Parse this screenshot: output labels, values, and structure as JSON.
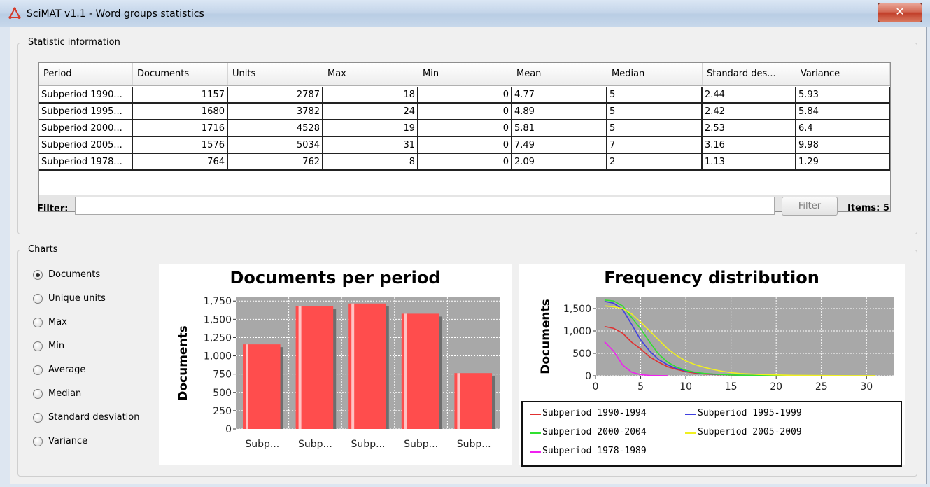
{
  "window": {
    "title": "SciMAT v1.1 - Word groups statistics",
    "close_glyph": "✕"
  },
  "statistic_group": {
    "label": "Statistic information",
    "columns": [
      "Period",
      "Documents",
      "Units",
      "Max",
      "Min",
      "Mean",
      "Median",
      "Standard des...",
      "Variance"
    ],
    "rows": [
      [
        "Subperiod 1990...",
        "1157",
        "2787",
        "18",
        "0",
        "4.77",
        "5",
        "2.44",
        "5.93"
      ],
      [
        "Subperiod 1995...",
        "1680",
        "3782",
        "24",
        "0",
        "4.89",
        "5",
        "2.42",
        "5.84"
      ],
      [
        "Subperiod 2000...",
        "1716",
        "4528",
        "19",
        "0",
        "5.81",
        "5",
        "2.53",
        "6.4"
      ],
      [
        "Subperiod 2005...",
        "1576",
        "5034",
        "31",
        "0",
        "7.49",
        "7",
        "3.16",
        "9.98"
      ],
      [
        "Subperiod 1978...",
        "764",
        "762",
        "8",
        "0",
        "2.09",
        "2",
        "1.13",
        "1.29"
      ]
    ],
    "filter_label": "Filter:",
    "filter_value": "",
    "filter_button": "Filter",
    "items_label": "Items: 5"
  },
  "charts_group": {
    "label": "Charts",
    "options": [
      {
        "label": "Documents",
        "selected": true
      },
      {
        "label": "Unique units",
        "selected": false
      },
      {
        "label": "Max",
        "selected": false
      },
      {
        "label": "Min",
        "selected": false
      },
      {
        "label": "Average",
        "selected": false
      },
      {
        "label": "Median",
        "selected": false
      },
      {
        "label": "Standard desviation",
        "selected": false
      },
      {
        "label": "Variance",
        "selected": false
      }
    ]
  },
  "chart_data": [
    {
      "type": "bar",
      "title": "Documents per period",
      "xlabel": "",
      "ylabel": "Documents",
      "categories": [
        "Subp...",
        "Subp...",
        "Subp...",
        "Subp...",
        "Subp..."
      ],
      "values": [
        1157,
        1680,
        1716,
        1576,
        764
      ],
      "ylim": [
        0,
        1800
      ],
      "yticks": [
        0,
        250,
        500,
        750,
        1000,
        1250,
        1500,
        1750
      ],
      "ytick_labels": [
        "0",
        "250",
        "500",
        "750",
        "1,000",
        "1,250",
        "1,500",
        "1,750"
      ],
      "grid": true,
      "colors": {
        "bar": "#ff4d4d",
        "plot_bg": "#a8a8a8",
        "shadow": "#6e6e6e",
        "grid": "#ffffff"
      }
    },
    {
      "type": "line",
      "title": "Frequency distribution",
      "xlabel": "",
      "ylabel": "Documents",
      "xlim": [
        0,
        33
      ],
      "ylim": [
        0,
        1750
      ],
      "xticks": [
        0,
        5,
        10,
        15,
        20,
        25,
        30
      ],
      "yticks": [
        0,
        500,
        1000,
        1500
      ],
      "ytick_labels": [
        "0",
        "500",
        "1,000",
        "1,500"
      ],
      "grid": true,
      "legend_position": "bottom",
      "colors": {
        "plot_bg": "#a8a8a8",
        "grid": "#ffffff"
      },
      "series": [
        {
          "name": "Subperiod 1990-1994",
          "color": "#e03030",
          "x": [
            1,
            2,
            3,
            4,
            5,
            6,
            7,
            8,
            9,
            10,
            11,
            12,
            13,
            14,
            15,
            16,
            18,
            20,
            22,
            24
          ],
          "y": [
            1100,
            1060,
            950,
            750,
            600,
            420,
            300,
            200,
            140,
            90,
            60,
            40,
            30,
            20,
            15,
            10,
            6,
            4,
            2,
            1
          ]
        },
        {
          "name": "Subperiod 1995-1999",
          "color": "#4040e0",
          "x": [
            1,
            2,
            3,
            4,
            5,
            6,
            7,
            8,
            9,
            10,
            11,
            12,
            13,
            14,
            15,
            16,
            18,
            20,
            22,
            24
          ],
          "y": [
            1660,
            1620,
            1480,
            1150,
            800,
            550,
            360,
            240,
            160,
            110,
            75,
            50,
            35,
            25,
            18,
            12,
            7,
            4,
            2,
            1
          ]
        },
        {
          "name": "Subperiod 2000-2004",
          "color": "#30e030",
          "x": [
            1,
            2,
            3,
            4,
            5,
            6,
            7,
            8,
            9,
            10,
            11,
            12,
            13,
            14,
            15,
            16,
            18,
            20,
            22,
            24
          ],
          "y": [
            1690,
            1670,
            1560,
            1300,
            1050,
            750,
            480,
            300,
            190,
            120,
            80,
            55,
            38,
            26,
            18,
            12,
            7,
            4,
            2,
            1
          ]
        },
        {
          "name": "Subperiod 2005-2009",
          "color": "#f0f020",
          "x": [
            1,
            2,
            3,
            4,
            5,
            6,
            7,
            8,
            9,
            10,
            11,
            12,
            13,
            14,
            15,
            16,
            18,
            20,
            22,
            24,
            28,
            31
          ],
          "y": [
            1560,
            1540,
            1500,
            1380,
            1200,
            1000,
            800,
            600,
            450,
            330,
            250,
            190,
            140,
            100,
            70,
            50,
            30,
            18,
            10,
            6,
            2,
            1
          ]
        },
        {
          "name": "Subperiod 1978-1989",
          "color": "#f020f0",
          "x": [
            1,
            2,
            3,
            4,
            5,
            6,
            7,
            8
          ],
          "y": [
            760,
            550,
            240,
            80,
            25,
            8,
            3,
            1
          ]
        }
      ]
    }
  ]
}
